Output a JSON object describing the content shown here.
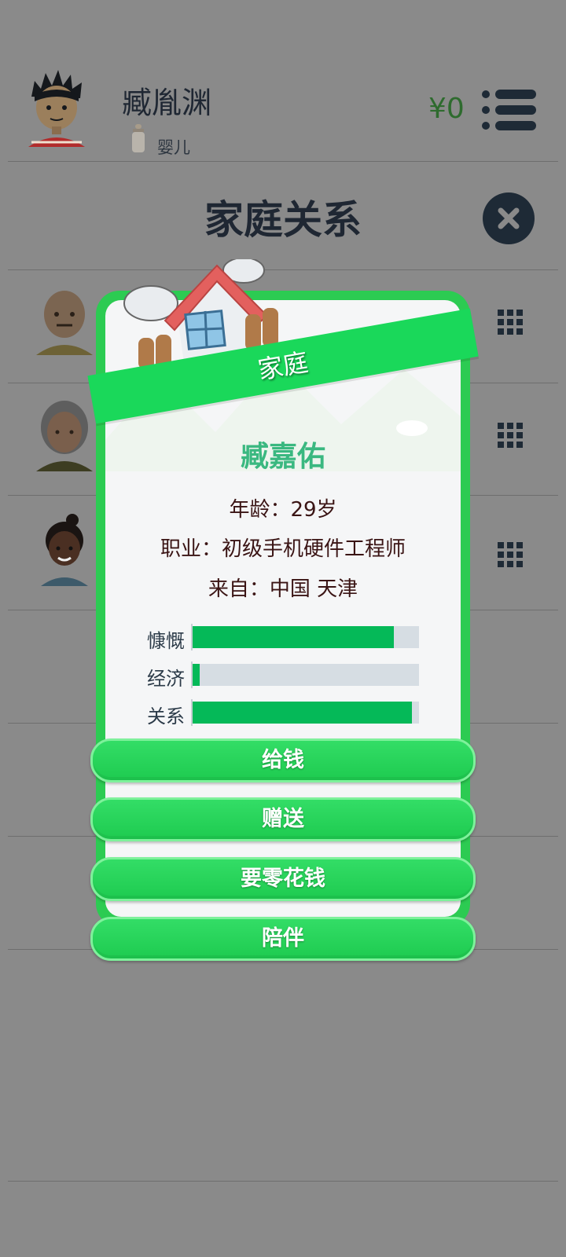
{
  "header": {
    "player_name": "臧胤渊",
    "life_stage": "婴儿",
    "money": "¥0",
    "icons": {
      "menu": "menu-list-icon",
      "stage": "baby-bottle-icon"
    }
  },
  "page": {
    "title": "家庭关系",
    "close_icon": "close-icon"
  },
  "family_rows": [
    {
      "avatar": "grandfather-avatar",
      "action_icon": "grid-icon"
    },
    {
      "avatar": "grandmother-avatar",
      "action_icon": "grid-icon"
    },
    {
      "avatar": "mother-avatar",
      "action_icon": "grid-icon"
    }
  ],
  "modal": {
    "banner": "家庭",
    "name": "臧嘉佑",
    "age_line": "年龄：29岁",
    "job_line": "职业：初级手机硬件工程师",
    "from_line": "来自：中国 天津",
    "stats": [
      {
        "label": "慷慨",
        "value": 0.89
      },
      {
        "label": "经济",
        "value": 0.03
      },
      {
        "label": "关系",
        "value": 0.97
      }
    ],
    "actions": [
      "给钱",
      "赠送",
      "要零花钱",
      "陪伴"
    ]
  },
  "colors": {
    "overlay": "#8a8a8a",
    "modal_border": "#2ccb52",
    "banner": "#1ad85a",
    "bar_fill": "#05b958",
    "bar_track": "#d6dde3",
    "name_color": "#3ab880"
  }
}
